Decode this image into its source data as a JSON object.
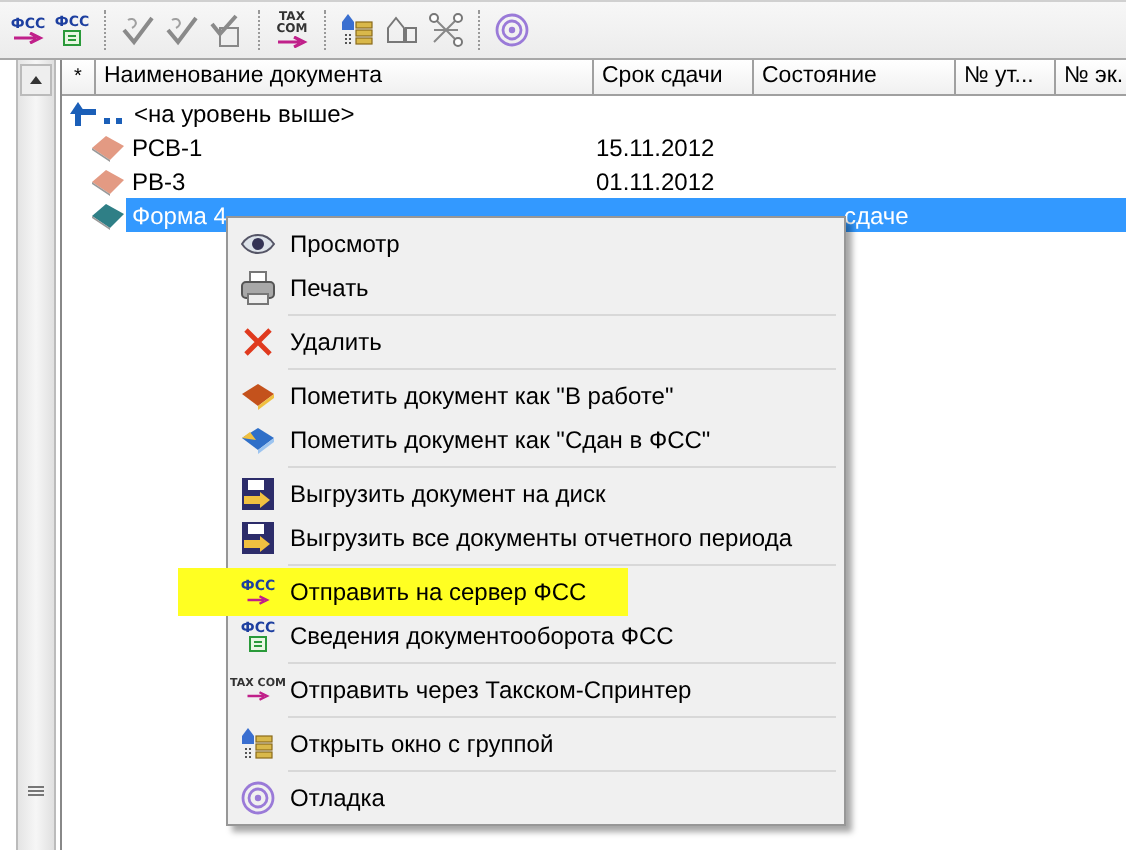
{
  "toolbar": {
    "buttons": [
      {
        "kind": "fss-send",
        "icon_text": "ФСС"
      },
      {
        "kind": "fss-info",
        "icon_text": "ФСС"
      },
      {
        "kind": "separator"
      },
      {
        "kind": "check"
      },
      {
        "kind": "check"
      },
      {
        "kind": "doc-check"
      },
      {
        "kind": "separator"
      },
      {
        "kind": "tax",
        "icon_text": "TAX COM"
      },
      {
        "kind": "separator"
      },
      {
        "kind": "group"
      },
      {
        "kind": "shapes"
      },
      {
        "kind": "network"
      },
      {
        "kind": "separator"
      },
      {
        "kind": "target"
      }
    ]
  },
  "table": {
    "columns": [
      "*",
      "Наименование документа",
      "Срок сдачи",
      "Состояние",
      "№ ут...",
      "№ эк."
    ],
    "rows": [
      {
        "kind": "up",
        "name": "<на уровень выше>",
        "selected": false
      },
      {
        "kind": "doc",
        "name": "РСВ-1",
        "date": "15.11.2012",
        "color": "#e39a83",
        "selected": false
      },
      {
        "kind": "doc",
        "name": "РВ-3",
        "date": "01.11.2012",
        "color": "#e39a83",
        "selected": false
      },
      {
        "kind": "doc",
        "name": "Форма 4",
        "status": "сдаче",
        "color": "#2f7f86",
        "selected": true
      }
    ]
  },
  "context_menu": {
    "groups": [
      [
        {
          "label": "Просмотр",
          "highlighted": false
        },
        {
          "label": "Печать",
          "highlighted": false
        }
      ],
      [
        {
          "label": "Удалить",
          "highlighted": false
        }
      ],
      [
        {
          "label": "Пометить документ как \"В работе\"",
          "highlighted": false
        },
        {
          "label": "Пометить документ как \"Сдан в ФСС\"",
          "highlighted": false
        }
      ],
      [
        {
          "label": "Выгрузить документ на диск",
          "highlighted": false
        },
        {
          "label": "Выгрузить все документы отчетного периода",
          "highlighted": false
        }
      ],
      [
        {
          "label": "Отправить на сервер ФСС",
          "icon_text": "ФСС",
          "highlighted": true
        },
        {
          "label": "Сведения документооборота ФСС",
          "icon_text": "ФСС",
          "highlighted": false
        }
      ],
      [
        {
          "label": "Отправить через Такском-Спринтер",
          "icon_text": "TAX COM",
          "highlighted": false
        }
      ],
      [
        {
          "label": "Открыть окно с группой",
          "highlighted": false
        }
      ],
      [
        {
          "label": "Отладка",
          "highlighted": false
        }
      ]
    ]
  }
}
